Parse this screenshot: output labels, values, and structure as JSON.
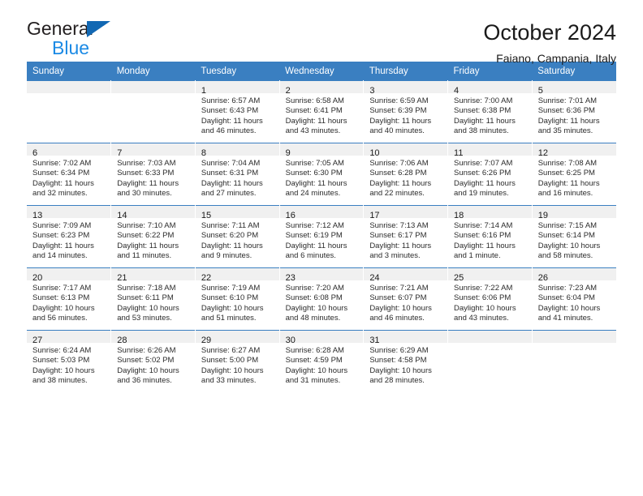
{
  "brand": {
    "name_part1": "General",
    "name_part2": "Blue",
    "triangle_color": "#1268b3",
    "blue_color": "#1b8ae5"
  },
  "header": {
    "title": "October 2024",
    "subtitle": "Faiano, Campania, Italy"
  },
  "theme": {
    "header_bg": "#3a7fc1",
    "daynum_band_bg": "#f0f0f0",
    "grid_line": "#3a7fc1"
  },
  "weekday_headers": [
    "Sunday",
    "Monday",
    "Tuesday",
    "Wednesday",
    "Thursday",
    "Friday",
    "Saturday"
  ],
  "weeks": [
    [
      {
        "day": "",
        "sunrise": "",
        "sunset": "",
        "daylight1": "",
        "daylight2": ""
      },
      {
        "day": "",
        "sunrise": "",
        "sunset": "",
        "daylight1": "",
        "daylight2": ""
      },
      {
        "day": "1",
        "sunrise": "Sunrise: 6:57 AM",
        "sunset": "Sunset: 6:43 PM",
        "daylight1": "Daylight: 11 hours",
        "daylight2": "and 46 minutes."
      },
      {
        "day": "2",
        "sunrise": "Sunrise: 6:58 AM",
        "sunset": "Sunset: 6:41 PM",
        "daylight1": "Daylight: 11 hours",
        "daylight2": "and 43 minutes."
      },
      {
        "day": "3",
        "sunrise": "Sunrise: 6:59 AM",
        "sunset": "Sunset: 6:39 PM",
        "daylight1": "Daylight: 11 hours",
        "daylight2": "and 40 minutes."
      },
      {
        "day": "4",
        "sunrise": "Sunrise: 7:00 AM",
        "sunset": "Sunset: 6:38 PM",
        "daylight1": "Daylight: 11 hours",
        "daylight2": "and 38 minutes."
      },
      {
        "day": "5",
        "sunrise": "Sunrise: 7:01 AM",
        "sunset": "Sunset: 6:36 PM",
        "daylight1": "Daylight: 11 hours",
        "daylight2": "and 35 minutes."
      }
    ],
    [
      {
        "day": "6",
        "sunrise": "Sunrise: 7:02 AM",
        "sunset": "Sunset: 6:34 PM",
        "daylight1": "Daylight: 11 hours",
        "daylight2": "and 32 minutes."
      },
      {
        "day": "7",
        "sunrise": "Sunrise: 7:03 AM",
        "sunset": "Sunset: 6:33 PM",
        "daylight1": "Daylight: 11 hours",
        "daylight2": "and 30 minutes."
      },
      {
        "day": "8",
        "sunrise": "Sunrise: 7:04 AM",
        "sunset": "Sunset: 6:31 PM",
        "daylight1": "Daylight: 11 hours",
        "daylight2": "and 27 minutes."
      },
      {
        "day": "9",
        "sunrise": "Sunrise: 7:05 AM",
        "sunset": "Sunset: 6:30 PM",
        "daylight1": "Daylight: 11 hours",
        "daylight2": "and 24 minutes."
      },
      {
        "day": "10",
        "sunrise": "Sunrise: 7:06 AM",
        "sunset": "Sunset: 6:28 PM",
        "daylight1": "Daylight: 11 hours",
        "daylight2": "and 22 minutes."
      },
      {
        "day": "11",
        "sunrise": "Sunrise: 7:07 AM",
        "sunset": "Sunset: 6:26 PM",
        "daylight1": "Daylight: 11 hours",
        "daylight2": "and 19 minutes."
      },
      {
        "day": "12",
        "sunrise": "Sunrise: 7:08 AM",
        "sunset": "Sunset: 6:25 PM",
        "daylight1": "Daylight: 11 hours",
        "daylight2": "and 16 minutes."
      }
    ],
    [
      {
        "day": "13",
        "sunrise": "Sunrise: 7:09 AM",
        "sunset": "Sunset: 6:23 PM",
        "daylight1": "Daylight: 11 hours",
        "daylight2": "and 14 minutes."
      },
      {
        "day": "14",
        "sunrise": "Sunrise: 7:10 AM",
        "sunset": "Sunset: 6:22 PM",
        "daylight1": "Daylight: 11 hours",
        "daylight2": "and 11 minutes."
      },
      {
        "day": "15",
        "sunrise": "Sunrise: 7:11 AM",
        "sunset": "Sunset: 6:20 PM",
        "daylight1": "Daylight: 11 hours",
        "daylight2": "and 9 minutes."
      },
      {
        "day": "16",
        "sunrise": "Sunrise: 7:12 AM",
        "sunset": "Sunset: 6:19 PM",
        "daylight1": "Daylight: 11 hours",
        "daylight2": "and 6 minutes."
      },
      {
        "day": "17",
        "sunrise": "Sunrise: 7:13 AM",
        "sunset": "Sunset: 6:17 PM",
        "daylight1": "Daylight: 11 hours",
        "daylight2": "and 3 minutes."
      },
      {
        "day": "18",
        "sunrise": "Sunrise: 7:14 AM",
        "sunset": "Sunset: 6:16 PM",
        "daylight1": "Daylight: 11 hours",
        "daylight2": "and 1 minute."
      },
      {
        "day": "19",
        "sunrise": "Sunrise: 7:15 AM",
        "sunset": "Sunset: 6:14 PM",
        "daylight1": "Daylight: 10 hours",
        "daylight2": "and 58 minutes."
      }
    ],
    [
      {
        "day": "20",
        "sunrise": "Sunrise: 7:17 AM",
        "sunset": "Sunset: 6:13 PM",
        "daylight1": "Daylight: 10 hours",
        "daylight2": "and 56 minutes."
      },
      {
        "day": "21",
        "sunrise": "Sunrise: 7:18 AM",
        "sunset": "Sunset: 6:11 PM",
        "daylight1": "Daylight: 10 hours",
        "daylight2": "and 53 minutes."
      },
      {
        "day": "22",
        "sunrise": "Sunrise: 7:19 AM",
        "sunset": "Sunset: 6:10 PM",
        "daylight1": "Daylight: 10 hours",
        "daylight2": "and 51 minutes."
      },
      {
        "day": "23",
        "sunrise": "Sunrise: 7:20 AM",
        "sunset": "Sunset: 6:08 PM",
        "daylight1": "Daylight: 10 hours",
        "daylight2": "and 48 minutes."
      },
      {
        "day": "24",
        "sunrise": "Sunrise: 7:21 AM",
        "sunset": "Sunset: 6:07 PM",
        "daylight1": "Daylight: 10 hours",
        "daylight2": "and 46 minutes."
      },
      {
        "day": "25",
        "sunrise": "Sunrise: 7:22 AM",
        "sunset": "Sunset: 6:06 PM",
        "daylight1": "Daylight: 10 hours",
        "daylight2": "and 43 minutes."
      },
      {
        "day": "26",
        "sunrise": "Sunrise: 7:23 AM",
        "sunset": "Sunset: 6:04 PM",
        "daylight1": "Daylight: 10 hours",
        "daylight2": "and 41 minutes."
      }
    ],
    [
      {
        "day": "27",
        "sunrise": "Sunrise: 6:24 AM",
        "sunset": "Sunset: 5:03 PM",
        "daylight1": "Daylight: 10 hours",
        "daylight2": "and 38 minutes."
      },
      {
        "day": "28",
        "sunrise": "Sunrise: 6:26 AM",
        "sunset": "Sunset: 5:02 PM",
        "daylight1": "Daylight: 10 hours",
        "daylight2": "and 36 minutes."
      },
      {
        "day": "29",
        "sunrise": "Sunrise: 6:27 AM",
        "sunset": "Sunset: 5:00 PM",
        "daylight1": "Daylight: 10 hours",
        "daylight2": "and 33 minutes."
      },
      {
        "day": "30",
        "sunrise": "Sunrise: 6:28 AM",
        "sunset": "Sunset: 4:59 PM",
        "daylight1": "Daylight: 10 hours",
        "daylight2": "and 31 minutes."
      },
      {
        "day": "31",
        "sunrise": "Sunrise: 6:29 AM",
        "sunset": "Sunset: 4:58 PM",
        "daylight1": "Daylight: 10 hours",
        "daylight2": "and 28 minutes."
      },
      {
        "day": "",
        "sunrise": "",
        "sunset": "",
        "daylight1": "",
        "daylight2": ""
      },
      {
        "day": "",
        "sunrise": "",
        "sunset": "",
        "daylight1": "",
        "daylight2": ""
      }
    ]
  ]
}
